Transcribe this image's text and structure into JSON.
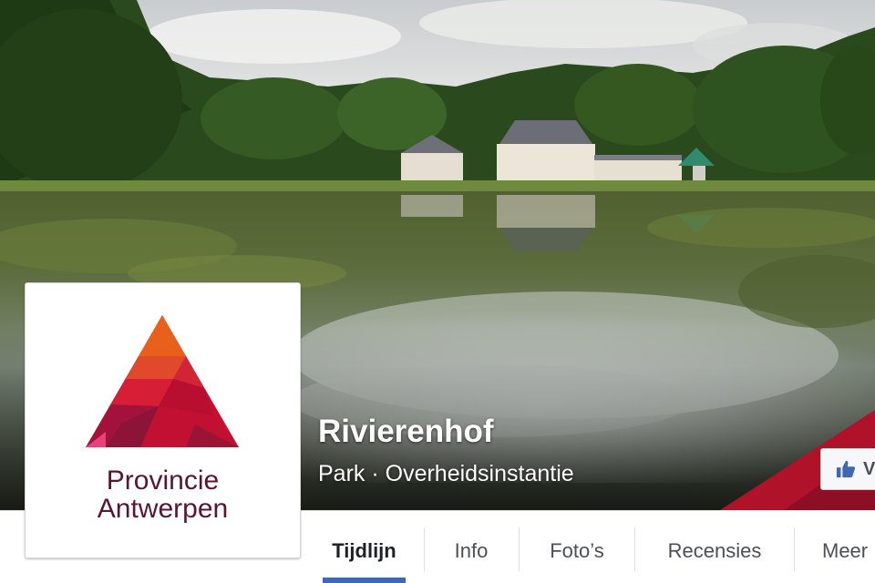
{
  "page": {
    "name": "Rivierenhof",
    "category": "Park · Overheidsinstantie"
  },
  "profile": {
    "logo_line1": "Provincie",
    "logo_line2": "Antwerpen",
    "logo_colors": [
      "#e8601c",
      "#c8102e",
      "#a3123a",
      "#7a1536"
    ],
    "logo_text_color": "#5a1530",
    "camera_icon": "camera-icon"
  },
  "like_button": {
    "label": "V",
    "icon": "thumbs-up-icon"
  },
  "tabs": [
    {
      "label": "Tijdlijn",
      "active": true
    },
    {
      "label": "Info",
      "active": false
    },
    {
      "label": "Foto’s",
      "active": false
    },
    {
      "label": "Recensies",
      "active": false
    },
    {
      "label": "Meer",
      "active": false
    }
  ],
  "colors": {
    "tab_indicator": "#4267b2",
    "accent_ribbon": "#b0122a",
    "like_icon": "#4267b2"
  }
}
